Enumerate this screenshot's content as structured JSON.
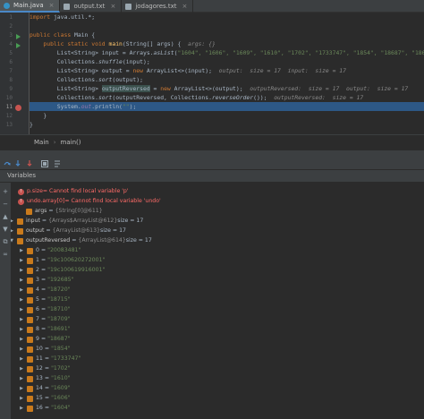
{
  "tabs": [
    {
      "label": "Main.java",
      "icon": "java-class-icon",
      "active": true
    },
    {
      "label": "output.txt",
      "icon": "text-file-icon",
      "active": false
    },
    {
      "label": "jodagores.txt",
      "icon": "text-file-icon",
      "active": false
    }
  ],
  "gutter": {
    "line_numbers": [
      "1",
      "2",
      "3",
      "4",
      "5",
      "6",
      "7",
      "8",
      "9",
      "10",
      "11",
      "12",
      "13"
    ]
  },
  "code": {
    "l1_kw": "import",
    "l1_rest": " java.util.*;",
    "l3_kw1": "public class",
    "l3_rest": " Main {",
    "l4_kw": "    public static void",
    "l4_fn": " main",
    "l4_rest": "(String[] args) {  ",
    "l4_hint": "args: {}",
    "l5_pre": "        List<String> input = Arrays.",
    "l5_fn": "asList",
    "l5_rest": "(",
    "l5_strs": "\"1604\", \"1606\", \"1609\", \"1610\", \"1702\", \"1733747\", \"1854\", \"18687\", \"186",
    "l6_pre": "        Collections.",
    "l6_fn": "shuffle",
    "l6_rest": "(input);",
    "l7_pre": "        List<String> output = ",
    "l7_kw": "new",
    "l7_rest": " ArrayList<>(input);  ",
    "l7_hint": "output:  size = 17  input:  size = 17",
    "l8_pre": "        Collections.",
    "l8_fn": "sort",
    "l8_rest": "(output);",
    "l9_pre": "        List<String> ",
    "l9_sel": "outputReversed",
    "l9_mid": " = ",
    "l9_kw": "new",
    "l9_rest": " ArrayList<>(output);  ",
    "l9_hint": "outputReversed:  size = 17  output:  size = 17",
    "l10_pre": "        Collections.",
    "l10_fn": "sort",
    "l10_rest": "(outputReversed, Collections.",
    "l10_fn2": "reverseOrder",
    "l10_rest2": "());  ",
    "l10_hint": "outputReversed:  size = 17",
    "l11_pre": "        System.",
    "l11_fld": "out",
    "l11_rest": ".println(",
    "l11_str": "\"\"",
    "l11_end": ");",
    "l12": "    }",
    "l13": "}"
  },
  "breadcrumb": {
    "items": [
      "Main",
      "main()"
    ]
  },
  "variables_panel": {
    "title": "Variables"
  },
  "variables": [
    {
      "kind": "error",
      "name": "p.size",
      "text": " = Cannot find local variable 'p'"
    },
    {
      "kind": "error",
      "name": "undo.array[0]",
      "text": " = Cannot find local variable 'undo'"
    },
    {
      "kind": "plain",
      "toggle": "",
      "name": "args",
      "eq": " = ",
      "typ": "{String[0]@611}",
      "extra": ""
    },
    {
      "kind": "plain",
      "toggle": "▶",
      "name": "input",
      "eq": " = ",
      "typ": "{Arrays$ArrayList@612}",
      "extra": "  size = 17"
    },
    {
      "kind": "plain",
      "toggle": "▶",
      "name": "output",
      "eq": " = ",
      "typ": "{ArrayList@613}",
      "extra": "  size = 17"
    },
    {
      "kind": "plain",
      "toggle": "▼",
      "name": "outputReversed",
      "eq": " = ",
      "typ": "{ArrayList@614}",
      "extra": "  size = 17"
    }
  ],
  "elements": [
    {
      "index": "0",
      "value": "\"20083481\""
    },
    {
      "index": "1",
      "value": "\"19c100620272001\""
    },
    {
      "index": "2",
      "value": "\"19c100619916001\""
    },
    {
      "index": "3",
      "value": "\"192685\""
    },
    {
      "index": "4",
      "value": "\"18720\""
    },
    {
      "index": "5",
      "value": "\"18715\""
    },
    {
      "index": "6",
      "value": "\"18710\""
    },
    {
      "index": "7",
      "value": "\"18709\""
    },
    {
      "index": "8",
      "value": "\"18691\""
    },
    {
      "index": "9",
      "value": "\"18687\""
    },
    {
      "index": "10",
      "value": "\"1854\""
    },
    {
      "index": "11",
      "value": "\"1733747\""
    },
    {
      "index": "12",
      "value": "\"1702\""
    },
    {
      "index": "13",
      "value": "\"1610\""
    },
    {
      "index": "14",
      "value": "\"1609\""
    },
    {
      "index": "15",
      "value": "\"1606\""
    },
    {
      "index": "16",
      "value": "\"1604\""
    }
  ],
  "colors": {
    "keyword": "#cc7832",
    "string": "#6a8759",
    "error": "#ff6b68",
    "current_line": "#2d5886",
    "breakpoint": "#c75450"
  }
}
